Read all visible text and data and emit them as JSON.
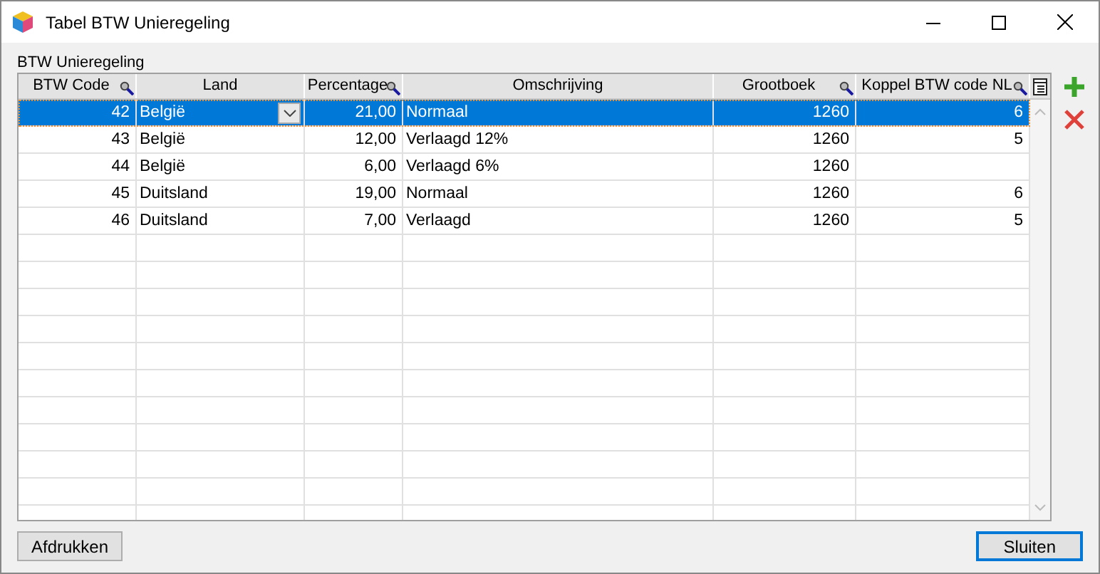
{
  "window": {
    "title": "Tabel BTW Unieregeling"
  },
  "group": {
    "label": "BTW Unieregeling"
  },
  "table": {
    "columns": [
      {
        "label": "BTW Code",
        "searchable": true,
        "kind": "number"
      },
      {
        "label": "Land",
        "searchable": false,
        "kind": "text"
      },
      {
        "label": "Percentage",
        "searchable": true,
        "kind": "number"
      },
      {
        "label": "Omschrijving",
        "searchable": false,
        "kind": "text"
      },
      {
        "label": "Grootboek",
        "searchable": true,
        "kind": "number"
      },
      {
        "label": "Koppel BTW code NL",
        "searchable": true,
        "kind": "number"
      }
    ],
    "rows": [
      {
        "selected": true,
        "cells": [
          "42",
          "België",
          "21,00",
          "Normaal",
          "1260",
          "6"
        ]
      },
      {
        "selected": false,
        "cells": [
          "43",
          "België",
          "12,00",
          "Verlaagd 12%",
          "1260",
          "5"
        ]
      },
      {
        "selected": false,
        "cells": [
          "44",
          "België",
          "6,00",
          "Verlaagd 6%",
          "1260",
          ""
        ]
      },
      {
        "selected": false,
        "cells": [
          "45",
          "Duitsland",
          "19,00",
          "Normaal",
          "1260",
          "6"
        ]
      },
      {
        "selected": false,
        "cells": [
          "46",
          "Duitsland",
          "7,00",
          "Verlaagd",
          "1260",
          "5"
        ]
      }
    ]
  },
  "buttons": [
    {
      "label": "Afdrukken",
      "default": false
    },
    {
      "label": "Sluiten",
      "default": true
    }
  ]
}
